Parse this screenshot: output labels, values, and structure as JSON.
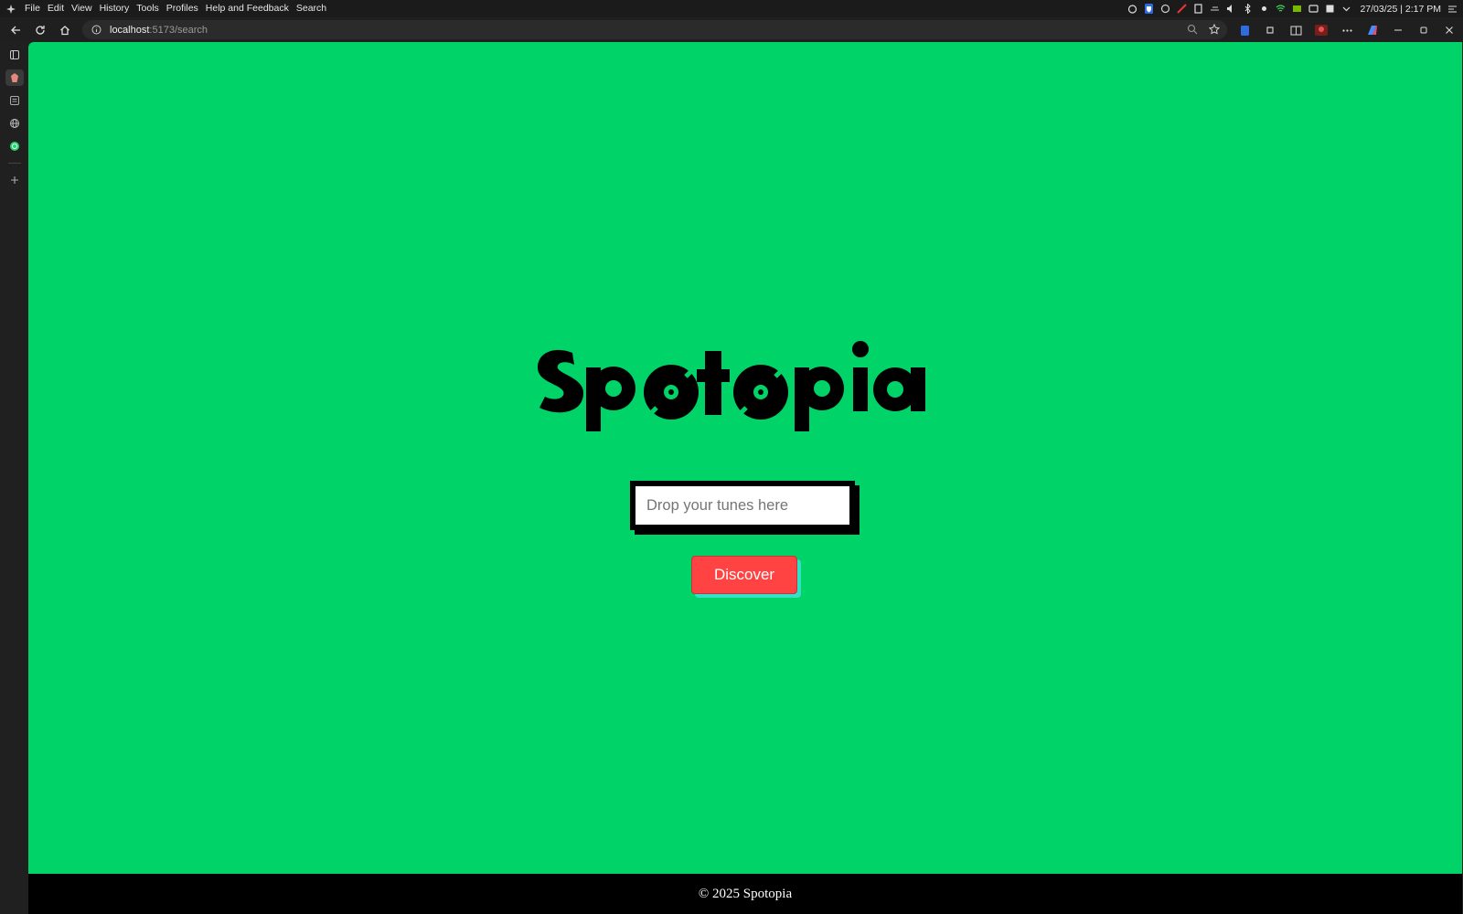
{
  "menubar": {
    "items": [
      "File",
      "Edit",
      "View",
      "History",
      "Tools",
      "Profiles",
      "Help and Feedback",
      "Search"
    ],
    "clock": "27/03/25 | 2:17 PM"
  },
  "toolbar": {
    "url_host": "localhost",
    "url_path": ":5173/search"
  },
  "page": {
    "logo_text": "Spotopia",
    "search": {
      "placeholder": "Drop your tunes here",
      "value": ""
    },
    "discover_label": "Discover",
    "footer_text": "© 2025 Spotopia"
  },
  "colors": {
    "background": "#00d468",
    "button": "#ff4242",
    "button_shadow": "#34e0c6",
    "footer": "#000000"
  },
  "icons": {
    "sidebar": [
      "sidebar-toggle-icon",
      "extension-icon",
      "collections-icon",
      "globe-icon",
      "whatsapp-icon",
      "add-icon"
    ]
  }
}
